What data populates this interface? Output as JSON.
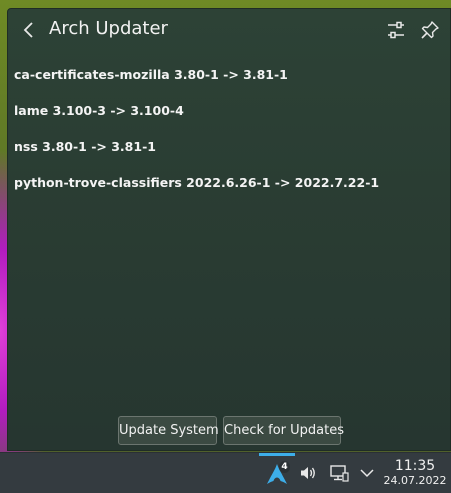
{
  "popup": {
    "title": "Arch Updater",
    "updates": [
      "ca-certificates-mozilla 3.80-1 -> 3.81-1",
      "lame 3.100-3 -> 3.100-4",
      "nss 3.80-1 -> 3.81-1",
      "python-trove-classifiers 2022.6.26-1 -> 2022.7.22-1"
    ],
    "buttons": {
      "update_system": "Update System",
      "check_updates": "Check for Updates"
    }
  },
  "taskbar": {
    "arch_icon": "arch-updater-icon",
    "arch_badge": "4",
    "icons": [
      "volume-icon",
      "network-icon",
      "chevron-down-icon"
    ],
    "clock": {
      "time": "11:35",
      "date": "24.07.2022"
    }
  },
  "colors": {
    "accent": "#3daee9",
    "popup_bg": "#2a3d33",
    "taskbar_bg": "#343b40"
  }
}
